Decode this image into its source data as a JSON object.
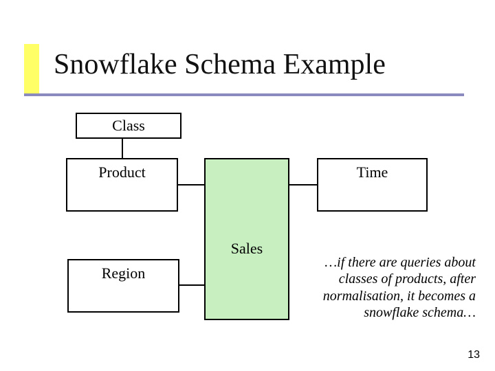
{
  "title": "Snowflake Schema Example",
  "nodes": {
    "class": {
      "label": "Class"
    },
    "product": {
      "label": "Product"
    },
    "time": {
      "label": "Time"
    },
    "sales": {
      "label": "Sales"
    },
    "region": {
      "label": "Region"
    }
  },
  "annotation": "…if there are queries about classes of products, after normalisation, it becomes a snowflake schema…",
  "page_number": "13"
}
